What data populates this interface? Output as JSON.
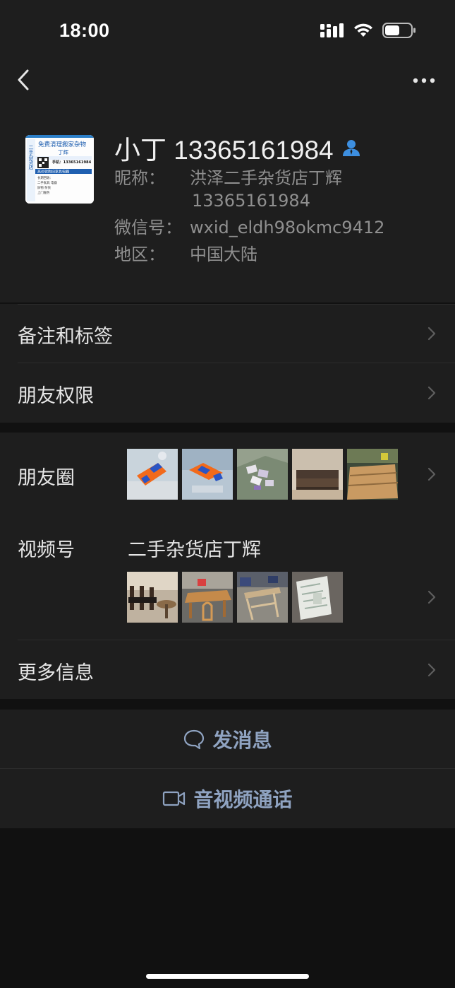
{
  "status_bar": {
    "time": "18:00",
    "icons": [
      "cellular-signal-icon",
      "wifi-icon",
      "battery-icon"
    ]
  },
  "topbar": {
    "back_icon": "chevron-left-icon",
    "more_icon": "more-dots-icon"
  },
  "profile": {
    "display_name": "小丁 13365161984",
    "contact_icon": "contact-person-icon",
    "avatar": {
      "vertical_text": "二手杂货店",
      "header": "免费清理搬家杂物",
      "name": "丁辉",
      "phone": "手机：13365161984",
      "slogan": "高价收购旧家具电器",
      "body_lines": [
        "长期回收：",
        "二手家具 电器",
        "旧物 杂货",
        "上门服务"
      ]
    },
    "fields": [
      {
        "label": "昵称：",
        "value_lines": [
          "洪泽二手杂货店丁辉",
          "13365161984"
        ]
      },
      {
        "label": "微信号：",
        "value_lines": [
          "wxid_eldh98okmc9412"
        ]
      },
      {
        "label": "地区：",
        "value_lines": [
          "中国大陆"
        ]
      }
    ]
  },
  "menu_group_1": [
    {
      "label": "备注和标签"
    },
    {
      "label": "朋友权限"
    }
  ],
  "moments": {
    "label": "朋友圈",
    "thumbnails": [
      "photo-orange-toy",
      "photo-orange-toy-2",
      "photo-bag-items",
      "photo-sofa",
      "photo-wood-tables"
    ]
  },
  "channels": {
    "label": "视频号",
    "channel_name": "二手杂货店丁辉",
    "thumbnails": [
      "photo-dining-chairs",
      "photo-wood-table-chairs",
      "photo-furniture-pile",
      "photo-paper-box"
    ]
  },
  "more_info": {
    "label": "更多信息"
  },
  "actions": {
    "message": {
      "label": "发消息",
      "icon": "chat-bubble-icon"
    },
    "call": {
      "label": "音视频通话",
      "icon": "video-camera-icon"
    }
  },
  "colors": {
    "background": "#111111",
    "card": "#1e1e1e",
    "action_text": "#8fa3c1",
    "contact_icon": "#3d8fe0"
  }
}
